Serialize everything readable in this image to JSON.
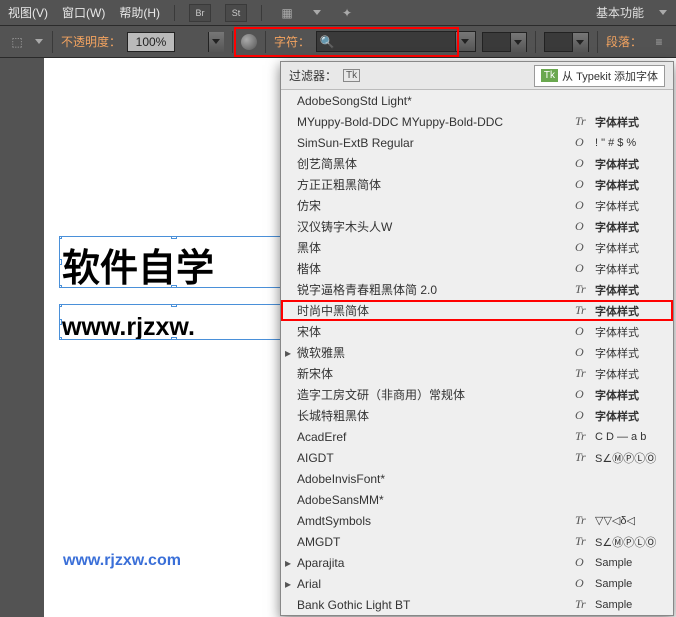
{
  "menu": {
    "view": "视图(V)",
    "window": "窗口(W)",
    "help": "帮助(H)",
    "br": "Br",
    "st": "St",
    "basic": "基本功能"
  },
  "toolbar": {
    "opacity_label": "不透明度：",
    "opacity_value": "100%",
    "char_label": "字符：",
    "para_label": "段落："
  },
  "canvas": {
    "text1": "软件自学",
    "text2": "www.rjzxw.",
    "watermark": "www.rjzxw.com"
  },
  "dd": {
    "filter_label": "过滤器：",
    "typekit": "从 Typekit 添加字体",
    "items": [
      {
        "name": "AdobeSongStd Light*",
        "type": "",
        "sample": "",
        "arrow": false
      },
      {
        "name": "MYuppy-Bold-DDC MYuppy-Bold-DDC",
        "type": "Tr",
        "sample": "字体样式",
        "bold": true,
        "arrow": false
      },
      {
        "name": "SimSun-ExtB Regular",
        "type": "O",
        "sample": "! \" # $ %",
        "arrow": false
      },
      {
        "name": "创艺简黑体",
        "type": "O",
        "sample": "字体样式",
        "bold": true,
        "arrow": false
      },
      {
        "name": "方正正粗黑简体",
        "type": "O",
        "sample": "字体样式",
        "bold": true,
        "arrow": false
      },
      {
        "name": "仿宋",
        "type": "O",
        "sample": "字体样式",
        "arrow": false,
        "serif": true
      },
      {
        "name": "汉仪铸字木头人W",
        "type": "O",
        "sample": "字体样式",
        "bold": true,
        "arrow": false
      },
      {
        "name": "黑体",
        "type": "O",
        "sample": "字体样式",
        "arrow": false
      },
      {
        "name": "楷体",
        "type": "O",
        "sample": "字体样式",
        "arrow": false,
        "serif": true
      },
      {
        "name": "锐字逼格青春粗黑体简 2.0",
        "type": "Tr",
        "sample": "字体样式",
        "bold": true,
        "arrow": false
      },
      {
        "name": "时尚中黑简体",
        "type": "Tr",
        "sample": "字体样式",
        "bold": true,
        "arrow": false,
        "hl": true
      },
      {
        "name": "宋体",
        "type": "O",
        "sample": "字体样式",
        "arrow": false,
        "serif": true
      },
      {
        "name": "微软雅黑",
        "type": "O",
        "sample": "字体样式",
        "arrow": true
      },
      {
        "name": "新宋体",
        "type": "Tr",
        "sample": "字体样式",
        "arrow": false,
        "serif": true
      },
      {
        "name": "造字工房文研（非商用）常规体",
        "type": "O",
        "sample": "字体样式",
        "bold": true,
        "arrow": false
      },
      {
        "name": "长城特粗黑体",
        "type": "O",
        "sample": "字体样式",
        "bold": true,
        "arrow": false
      },
      {
        "name": "AcadEref",
        "type": "Tr",
        "sample": "C D — a b",
        "arrow": false
      },
      {
        "name": "AIGDT",
        "type": "Tr",
        "sample": "S∠ⓂⓅⓁⓄ",
        "arrow": false
      },
      {
        "name": "AdobeInvisFont*",
        "type": "",
        "sample": "",
        "arrow": false
      },
      {
        "name": "AdobeSansMM*",
        "type": "",
        "sample": "",
        "arrow": false
      },
      {
        "name": "AmdtSymbols",
        "type": "Tr",
        "sample": "▽▽◁δ◁",
        "arrow": false
      },
      {
        "name": "AMGDT",
        "type": "Tr",
        "sample": "S∠ⓂⓅⓁⓄ",
        "arrow": false
      },
      {
        "name": "Aparajita",
        "type": "O",
        "sample": "Sample",
        "arrow": true
      },
      {
        "name": "Arial",
        "type": "O",
        "sample": "Sample",
        "arrow": true
      },
      {
        "name": "Bank Gothic Light BT",
        "type": "Tr",
        "sample": "Sample",
        "arrow": false
      }
    ]
  }
}
